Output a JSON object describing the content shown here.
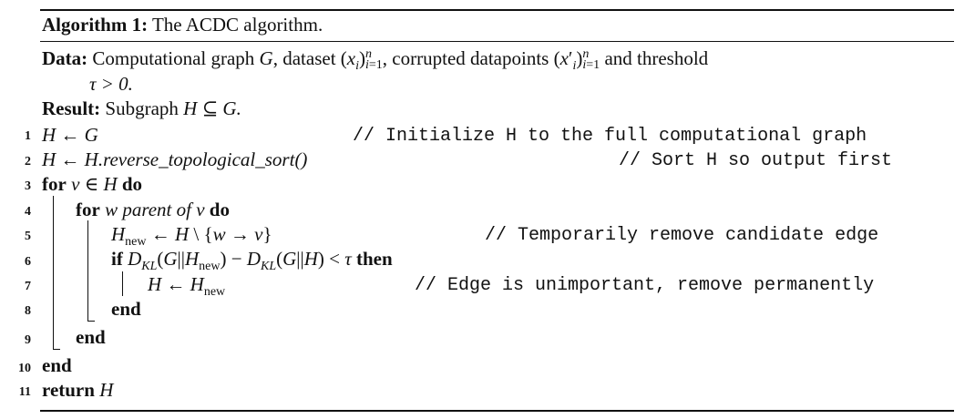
{
  "algorithm": {
    "caption_label": "Algorithm 1:",
    "caption_title": "The ACDC algorithm.",
    "data_label": "Data:",
    "data_text_1": "Computational graph",
    "data_G": "G",
    "data_text_2": ", dataset",
    "data_text_3": ", corrupted datapoints",
    "data_text_4": "and threshold",
    "data_tau": "τ > 0.",
    "result_label": "Result:",
    "result_text": "Subgraph",
    "result_expr": "H ⊆ G.",
    "lines": [
      {
        "num": "1"
      },
      {
        "num": "2"
      },
      {
        "num": "3"
      },
      {
        "num": "4"
      },
      {
        "num": "5"
      },
      {
        "num": "6"
      },
      {
        "num": "7"
      },
      {
        "num": "8"
      },
      {
        "num": "9"
      },
      {
        "num": "10"
      },
      {
        "num": "11"
      }
    ],
    "l1_code": "H ← G",
    "l1_comment": "// Initialize H to the full computational graph",
    "l2_code": "H ← H.reverse_topological_sort()",
    "l2_comment": "// Sort H so output first",
    "kw_for": "for",
    "kw_do": "do",
    "l3_expr": "v ∈ H",
    "l4_expr": "w parent of v",
    "l5_comment": "// Temporarily remove candidate edge",
    "kw_if": "if",
    "kw_then": "then",
    "l7_comment": "// Edge is unimportant, remove permanently",
    "kw_end": "end",
    "kw_return": "return",
    "l11_expr": "H"
  }
}
